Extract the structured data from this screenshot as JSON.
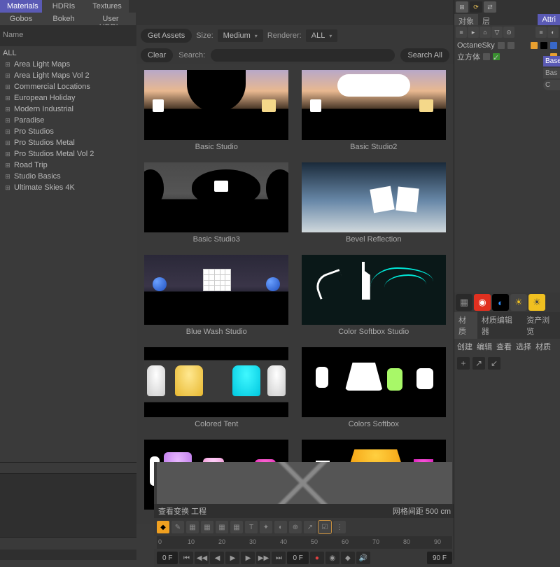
{
  "tabs": {
    "materials": "Materials",
    "hdris": "HDRIs",
    "textures": "Textures",
    "gobos": "Gobos",
    "bokeh": "Bokeh",
    "user_hdris": "User HDRIs"
  },
  "sidebar": {
    "header": "Name",
    "root": "ALL",
    "items": [
      "Area Light Maps",
      "Area Light Maps Vol 2",
      "Commercial Locations",
      "European Holiday",
      "Modern Industrial",
      "Paradise",
      "Pro Studios",
      "Pro Studios Metal",
      "Pro Studios Metal Vol 2",
      "Road Trip",
      "Studio Basics",
      "Ultimate Skies 4K"
    ],
    "selected_index": 10
  },
  "toolbar": {
    "get_assets": "Get Assets",
    "size_label": "Size:",
    "size_value": "Medium",
    "renderer_label": "Renderer:",
    "renderer_value": "ALL"
  },
  "searchbar": {
    "clear": "Clear",
    "search_label": "Search:",
    "search_all": "Search All",
    "placeholder": ""
  },
  "assets": [
    {
      "name": "Basic Studio"
    },
    {
      "name": "Basic Studio2"
    },
    {
      "name": "Basic Studio3"
    },
    {
      "name": "Bevel Reflection"
    },
    {
      "name": "Blue Wash Studio"
    },
    {
      "name": "Color Softbox Studio"
    },
    {
      "name": "Colored Tent"
    },
    {
      "name": "Colors Softbox"
    },
    {
      "name": ""
    },
    {
      "name": ""
    }
  ],
  "right": {
    "tabs": {
      "objects": "对象",
      "layers": "层",
      "attrib": "Attri"
    },
    "hierarchy": [
      {
        "name": "OctaneSky"
      },
      {
        "name": "立方体"
      }
    ],
    "attrib_items": [
      "Base",
      "Bas",
      "C"
    ],
    "mat_tabs": {
      "a": "材质",
      "b": "材质编辑器",
      "c": "资产浏览"
    },
    "small": [
      "创建",
      "编辑",
      "查看",
      "选择",
      "材质"
    ]
  },
  "timeline": {
    "info_left": "查看变换  工程",
    "info_right_label": "网格间距",
    "info_right_value": "500 cm",
    "ruler": [
      "0",
      "10",
      "20",
      "30",
      "40",
      "50",
      "60",
      "70",
      "80",
      "90"
    ],
    "frame_start": "0 F",
    "frame_cur": "0 F",
    "frame_end": "90 F"
  }
}
